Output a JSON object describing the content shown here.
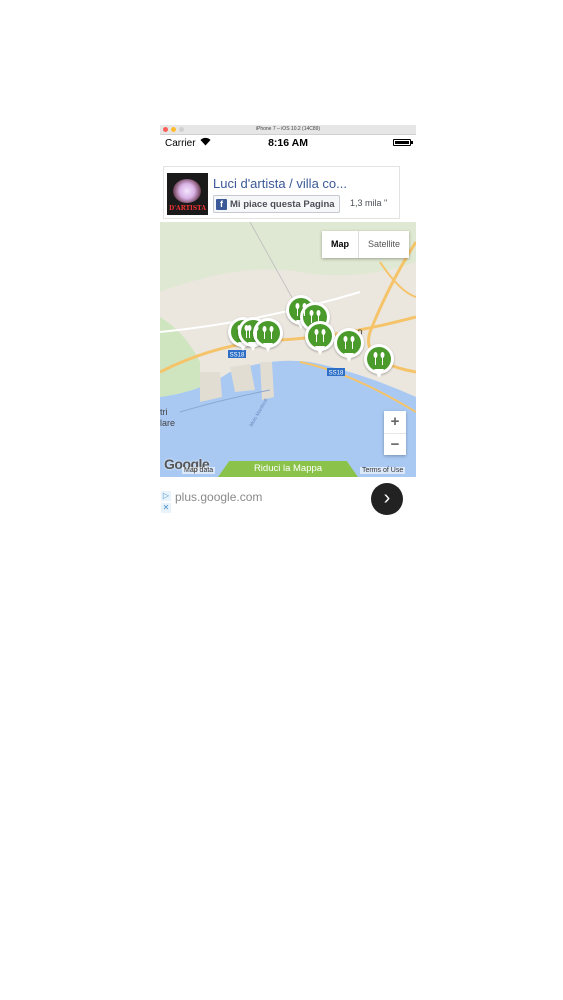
{
  "simulator": {
    "title": "iPhone 7 – iOS 10.2 (14C89)",
    "dots": [
      "#ff5f57",
      "#febc2e",
      "#d0d0d0"
    ]
  },
  "status_bar": {
    "carrier": "Carrier",
    "time": "8:16 AM"
  },
  "facebook_widget": {
    "page_name": "Luci d'artista / villa co...",
    "thumbnail_text": "D'ARTISTA",
    "like_button": "Mi piace questa Pagina",
    "like_count": "1,3 mila \""
  },
  "map": {
    "type_options": [
      "Map",
      "Satellite"
    ],
    "selected_type": "Map",
    "zoom_in": "+",
    "zoom_out": "−",
    "logo": "Google",
    "map_data": "Map data",
    "terms": "Terms of Use",
    "reduce_button": "Riduci la Mappa",
    "labels": {
      "road_1": "SS18",
      "road_2": "SS18",
      "partial_left_1": "tri",
      "partial_left_2": "lare",
      "partial_city": "co",
      "harbor": "Molo Manfredi"
    },
    "marker_count": 8,
    "colors": {
      "marker": "#4a9a2c",
      "sea": "#a9c9f2",
      "land": "#ebe7df",
      "road": "#f5c46a"
    }
  },
  "ad": {
    "url": "plus.google.com",
    "go_button": "›"
  }
}
